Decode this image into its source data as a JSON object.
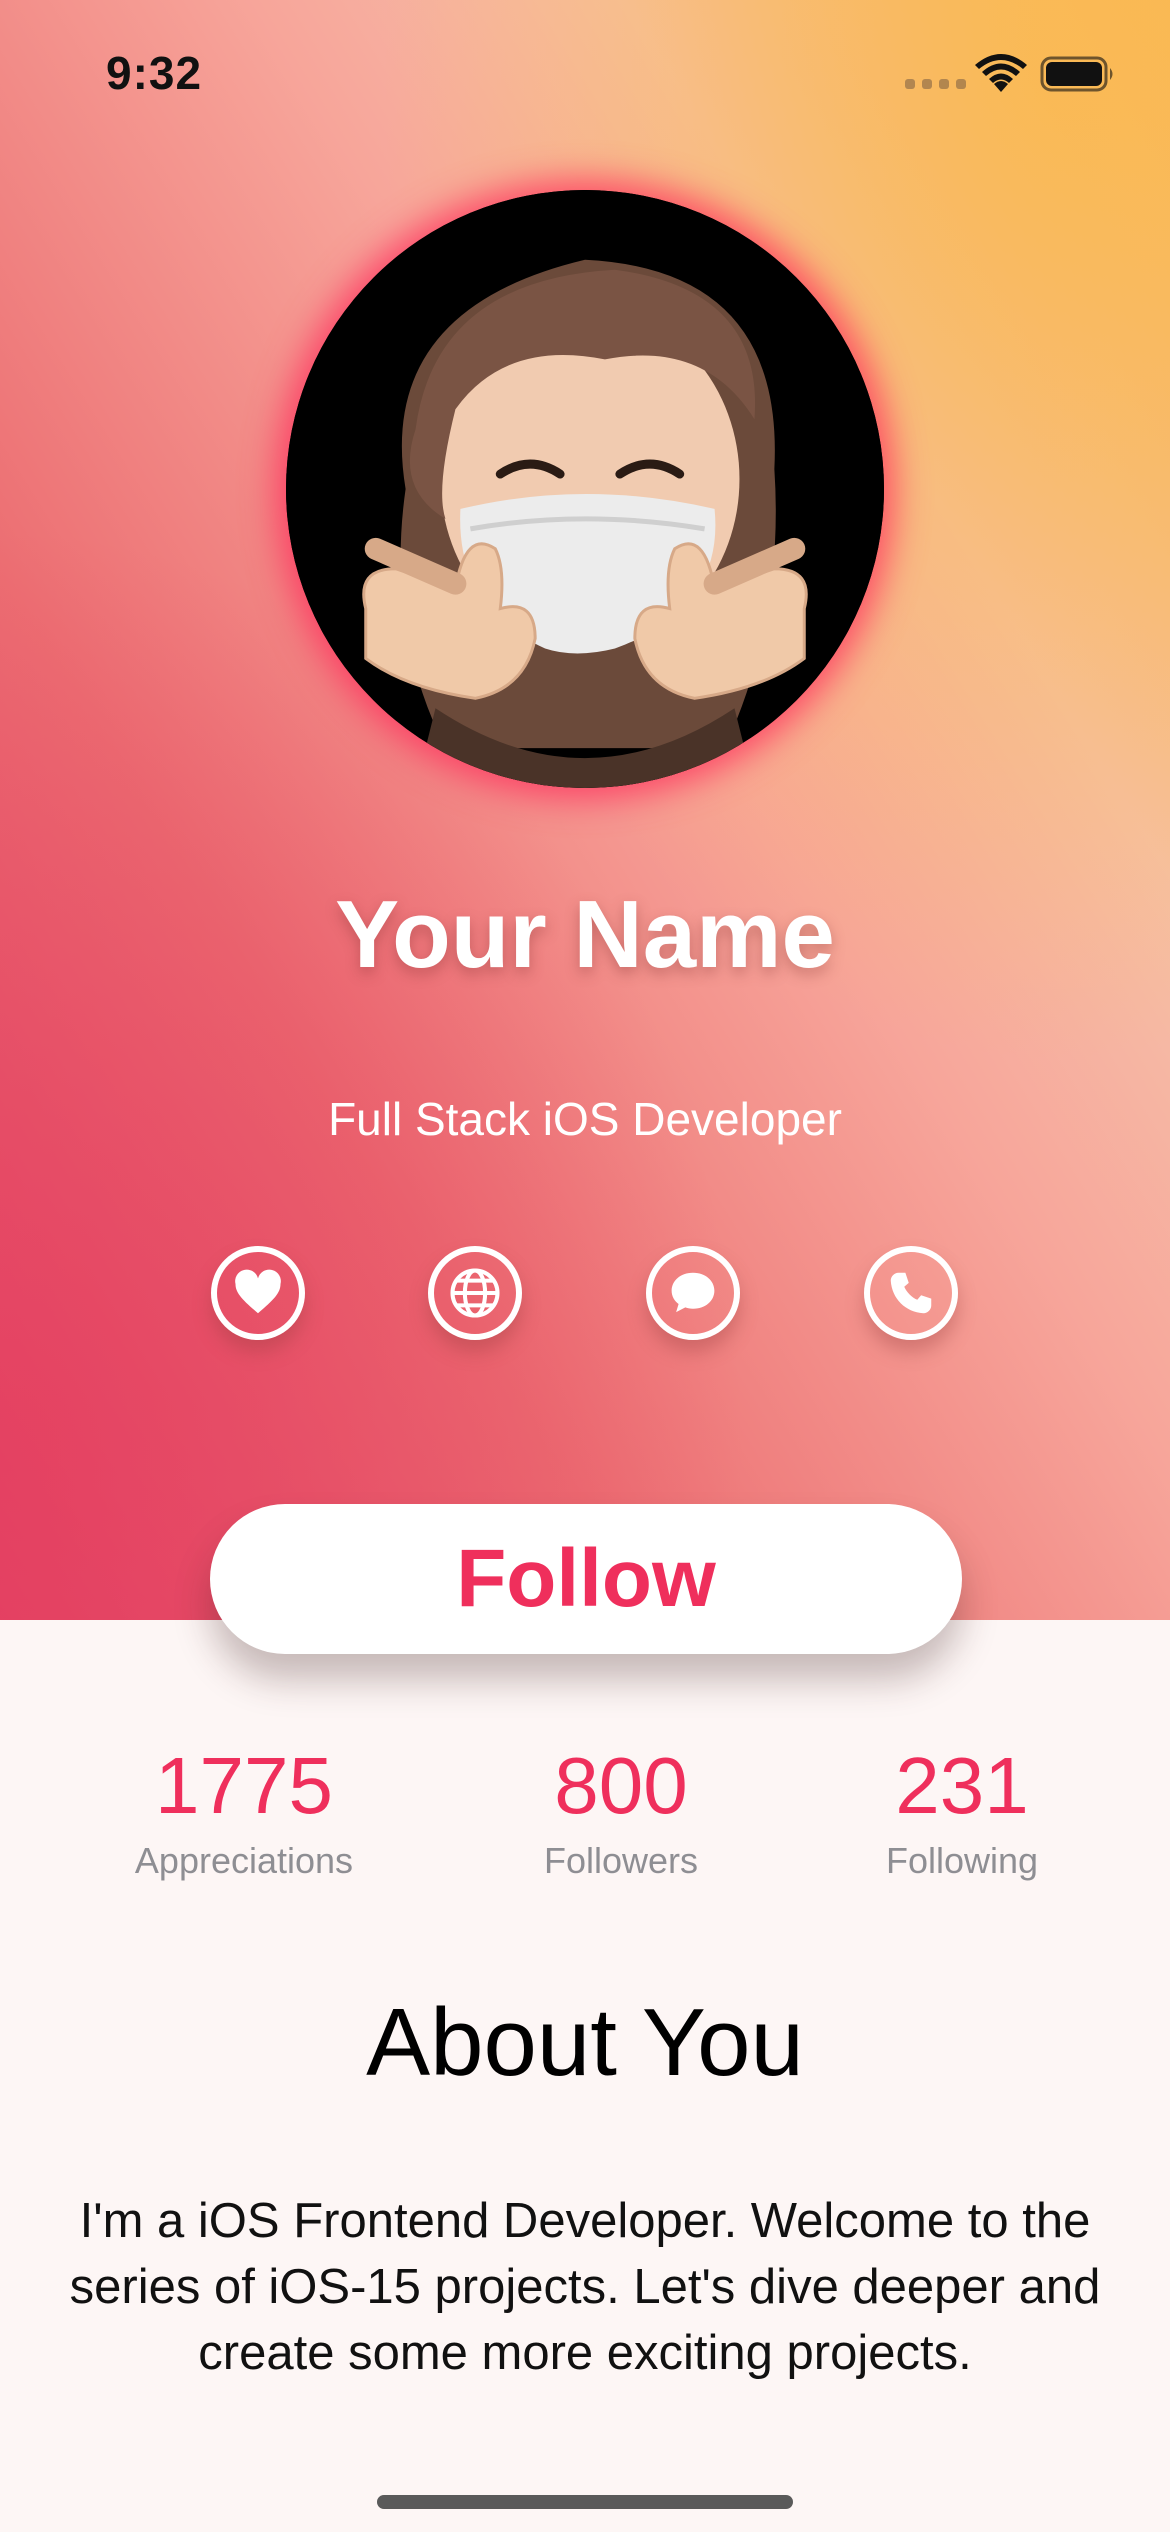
{
  "status_bar": {
    "time": "9:32",
    "signal_icon": "cellular-signal-icon",
    "wifi_icon": "wifi-icon",
    "battery_icon": "battery-icon"
  },
  "profile": {
    "avatar_icon": "memoji-avatar",
    "name": "Your Name",
    "role": "Full Stack iOS Developer"
  },
  "socials": [
    {
      "icon": "heart-icon"
    },
    {
      "icon": "globe-icon"
    },
    {
      "icon": "message-icon"
    },
    {
      "icon": "phone-icon"
    }
  ],
  "follow_label": "Follow",
  "stats": [
    {
      "value": "1775",
      "label": "Appreciations"
    },
    {
      "value": "800",
      "label": "Followers"
    },
    {
      "value": "231",
      "label": "Following"
    }
  ],
  "about": {
    "title": "About You",
    "text": "I'm a iOS Frontend Developer. Welcome to the series of iOS-15 projects. Let's dive deeper and create some more exciting projects."
  },
  "colors": {
    "accent": "#ef2f5c",
    "gradient_start": "#e44766",
    "gradient_end": "#f8b95a",
    "background": "#fdf6f5"
  }
}
